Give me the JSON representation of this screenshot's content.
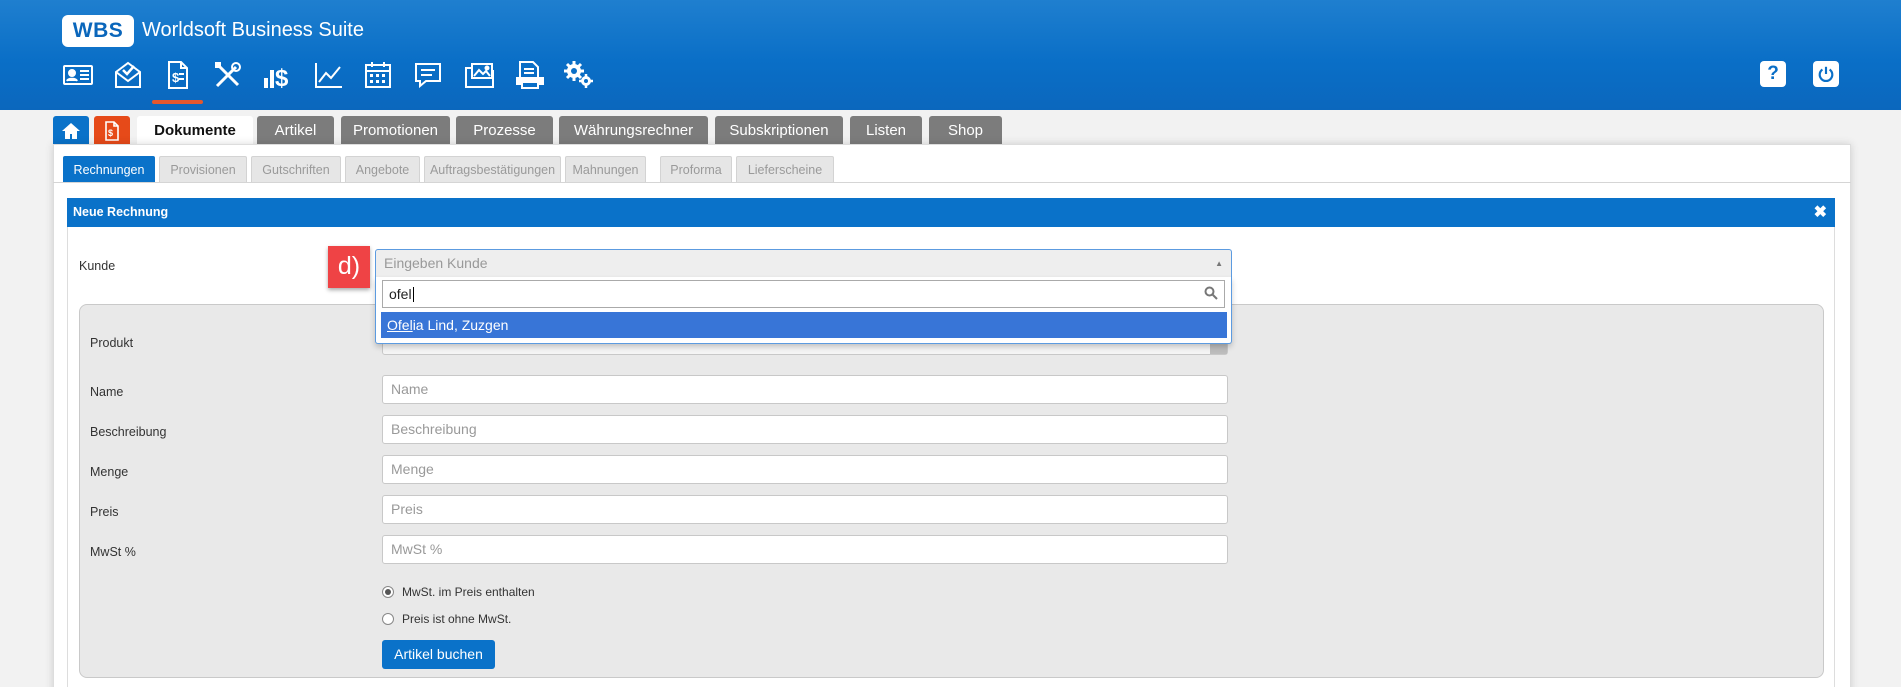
{
  "header": {
    "logo": "WBS",
    "app_title": "Worldsoft Business Suite",
    "toolbar_icons": [
      "contacts-icon",
      "mail-icon",
      "documents-icon",
      "tools-icon",
      "finance-icon",
      "statistics-icon",
      "calendar-icon",
      "chat-icon",
      "media-icon",
      "print-icon",
      "settings-icon"
    ],
    "help_label": "?",
    "power_icon": "power-icon"
  },
  "main_tabs": [
    "Dokumente",
    "Artikel",
    "Promotionen",
    "Prozesse",
    "Währungsrechner",
    "Subskriptionen",
    "Listen",
    "Shop"
  ],
  "sub_tabs": [
    "Rechnungen",
    "Provisionen",
    "Gutschriften",
    "Angebote",
    "Auftragsbestätigungen",
    "Mahnungen",
    "Proforma",
    "Lieferscheine"
  ],
  "dialog": {
    "title": "Neue Rechnung",
    "close": "✖",
    "step_marker": "d)",
    "labels": {
      "kunde": "Kunde",
      "produkt": "Produkt",
      "name": "Name",
      "beschreibung": "Beschreibung",
      "menge": "Menge",
      "preis": "Preis",
      "mwst": "MwSt %"
    },
    "kunde_select": {
      "placeholder": "Eingeben Kunde",
      "search_value": "ofel",
      "option_match": "Ofel",
      "option_rest": "ia Lind, Zuzgen"
    },
    "placeholders": {
      "name": "Name",
      "beschreibung": "Beschreibung",
      "menge": "Menge",
      "preis": "Preis",
      "mwst": "MwSt %"
    },
    "radios": {
      "incl": "MwSt. im Preis enthalten",
      "excl": "Preis ist ohne MwSt."
    },
    "submit": "Artikel buchen"
  },
  "colors": {
    "header_blue": "#0a6fc7",
    "accent_orange": "#e4572e",
    "tab_gray": "#7c7c7c",
    "highlight": "#3875d7",
    "step_red": "#ef4345"
  }
}
